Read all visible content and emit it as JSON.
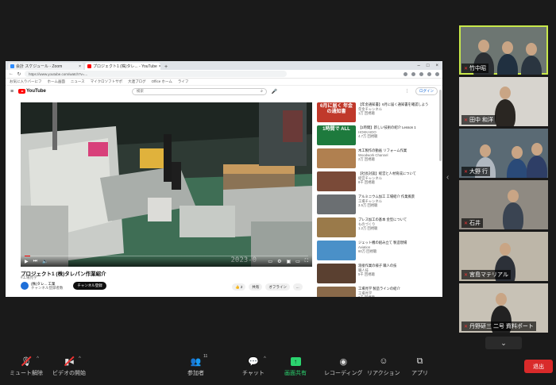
{
  "browser": {
    "tabs": [
      {
        "label": "会計 スケジュール - Zoom",
        "active": false
      },
      {
        "label": "プロジェクト1 (株)タレ... - YouTube",
        "active": true
      }
    ],
    "url": "https://www.youtube.com/watch?v=...",
    "bookmarks": [
      "お気に入りバーにフ",
      "ホーム画面",
      "ニュース",
      "マイクロソフトサポ",
      "大連ブログ",
      "Office ホーム",
      "ライフ"
    ]
  },
  "youtube": {
    "logo": "YouTube",
    "search_placeholder": "検索",
    "signin": "ログイン",
    "player": {
      "timestamp": "2023-0",
      "progress": 0.02
    },
    "video_title": "プロジェクト1 (株)タレパン作業紹介",
    "video_tag": "#工場見学",
    "channel": {
      "name": "(株)タレ... 工業",
      "subs": "チャンネル登録者数"
    },
    "subscribe": "チャンネル登録",
    "actions": [
      "👍 2",
      "共有",
      "オフライン",
      "..."
    ],
    "recommendations": [
      {
        "thumb_text": "6月に届く 年金の通知書",
        "title": "【年金通知書】6月に届く通知書を確認しよう",
        "channel": "年金チャンネル",
        "meta": "1万 回視聴",
        "color": "#c0392b"
      },
      {
        "thumb_text": "1時間で ALL",
        "title": "【1時間】新しい技術の紹介 Lesson 1",
        "channel": "HOKKAIDO",
        "meta": "4.7万 回視聴",
        "color": "#1e7a3d"
      },
      {
        "thumb_text": "",
        "title": "木工製作の動画 リフォーム作業",
        "channel": "Woodwork Channel",
        "meta": "2万 回視聴",
        "color": "#b08050"
      },
      {
        "thumb_text": "",
        "title": "【社長対談】経営と人材育成について",
        "channel": "経営チャンネル",
        "meta": "8千 回視聴",
        "color": "#7a4a38"
      },
      {
        "thumb_text": "",
        "title": "アルミニウム加工 工場紹介 作業風景",
        "channel": "工場チャンネル",
        "meta": "3.5万 回視聴",
        "color": "#6b6f72"
      },
      {
        "thumb_text": "",
        "title": "プレス加工の基本 金型について",
        "channel": "ものづくり",
        "meta": "1.2万 回視聴",
        "color": "#9a7a4a"
      },
      {
        "thumb_text": "",
        "title": "ジェット機の組み立て 製造現場",
        "channel": "Aviation",
        "meta": "60万 回視聴",
        "color": "#4a90c8"
      },
      {
        "thumb_text": "",
        "title": "溶接作業の様子 職人の技",
        "channel": "職人技",
        "meta": "5千 回視聴",
        "color": "#5a4030"
      },
      {
        "thumb_text": "",
        "title": "工場見学 製造ラインの紹介",
        "channel": "工場見学",
        "meta": "2千 回視聴",
        "color": "#8a6a4a"
      }
    ]
  },
  "participants": [
    {
      "name": "竹中昭",
      "active": true
    },
    {
      "name": "田中 和洋",
      "active": false
    },
    {
      "name": "大野 行",
      "active": false
    },
    {
      "name": "石井",
      "active": false
    },
    {
      "name": "宮島マテリアル",
      "active": false
    },
    {
      "name": "丹野研三 二号 資料ポート",
      "active": false
    }
  ],
  "toolbar": {
    "mute": "ミュート解除",
    "video": "ビデオの開始",
    "participants": "参加者",
    "participants_count": "11",
    "chat": "チャット",
    "share": "画面共有",
    "record": "レコーディング",
    "reactions": "リアクション",
    "apps": "アプリ",
    "leave": "退出"
  },
  "colors": {
    "accent": "#2bd46f",
    "leave": "#d92a2a",
    "active_border": "#c8e84a"
  }
}
